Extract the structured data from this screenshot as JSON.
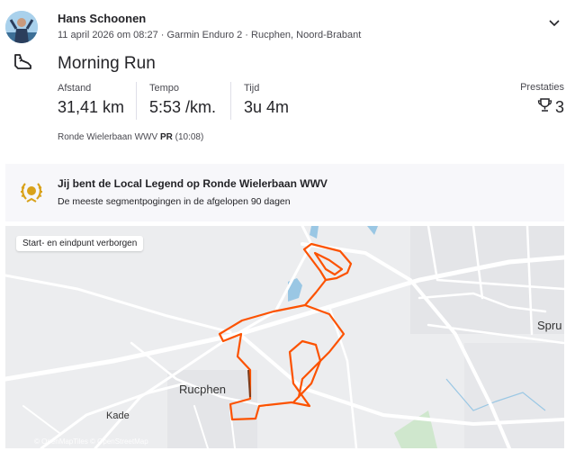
{
  "athlete": {
    "name": "Hans Schoonen",
    "meta": "11 april 2026 om 08:27 · Garmin Enduro 2 · Rucphen, Noord-Brabant"
  },
  "activity": {
    "title": "Morning Run",
    "stats": [
      {
        "label": "Afstand",
        "value": "31,41 km"
      },
      {
        "label": "Tempo",
        "value": "5:53 /km."
      },
      {
        "label": "Tijd",
        "value": "3u 4m"
      }
    ],
    "achievements": {
      "label": "Prestaties",
      "count": "3"
    },
    "segment": {
      "name": "Ronde Wielerbaan WWV",
      "badge": "PR",
      "time": "(10:08)"
    }
  },
  "local_legend": {
    "title": "Jij bent de Local Legend op Ronde Wielerbaan WWV",
    "subtitle": "De meeste segmentpogingen in de afgelopen 90 dagen"
  },
  "map": {
    "badge": "Start- en eindpunt verborgen",
    "labels": {
      "town": "Rucphen",
      "street": "Kade",
      "edge_town": "Spru"
    },
    "attribution": "© OpenMapTiles © OpenStreetMap",
    "route_color": "#fc5200"
  },
  "icons": [
    "chevron-down-icon",
    "running-shoe-icon",
    "trophy-icon",
    "laurel-icon"
  ]
}
